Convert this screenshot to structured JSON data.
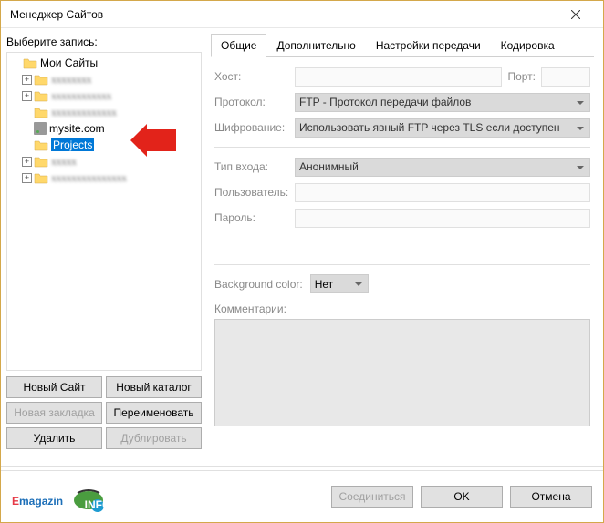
{
  "window": {
    "title": "Менеджер Сайтов"
  },
  "left": {
    "label": "Выберите запись:",
    "root": "Мои Сайты",
    "items": [
      {
        "text": "obscured1"
      },
      {
        "text": "obscured2"
      },
      {
        "text": "obscured3"
      },
      {
        "text": "mysite.com",
        "server": true
      },
      {
        "text": "Projects",
        "selected": true
      },
      {
        "text": "obscured4"
      },
      {
        "text": "obscured5"
      }
    ],
    "buttons": {
      "newSite": "Новый Сайт",
      "newFolder": "Новый каталог",
      "newBookmark": "Новая закладка",
      "rename": "Переименовать",
      "delete": "Удалить",
      "duplicate": "Дублировать"
    }
  },
  "tabs": {
    "general": "Общие",
    "advanced": "Дополнительно",
    "transfer": "Настройки передачи",
    "charset": "Кодировка"
  },
  "form": {
    "hostLabel": "Хост:",
    "portLabel": "Порт:",
    "protocolLabel": "Протокол:",
    "protocolValue": "FTP - Протокол передачи файлов",
    "encryptionLabel": "Шифрование:",
    "encryptionValue": "Использовать явный FTP через TLS если доступен",
    "logonLabel": "Тип входа:",
    "logonValue": "Анонимный",
    "userLabel": "Пользователь:",
    "passLabel": "Пароль:",
    "bgColorLabel": "Background color:",
    "bgColorValue": "Нет",
    "commentLabel": "Комментарии:"
  },
  "footer": {
    "connect": "Соединиться",
    "ok": "OK",
    "cancel": "Отмена"
  }
}
